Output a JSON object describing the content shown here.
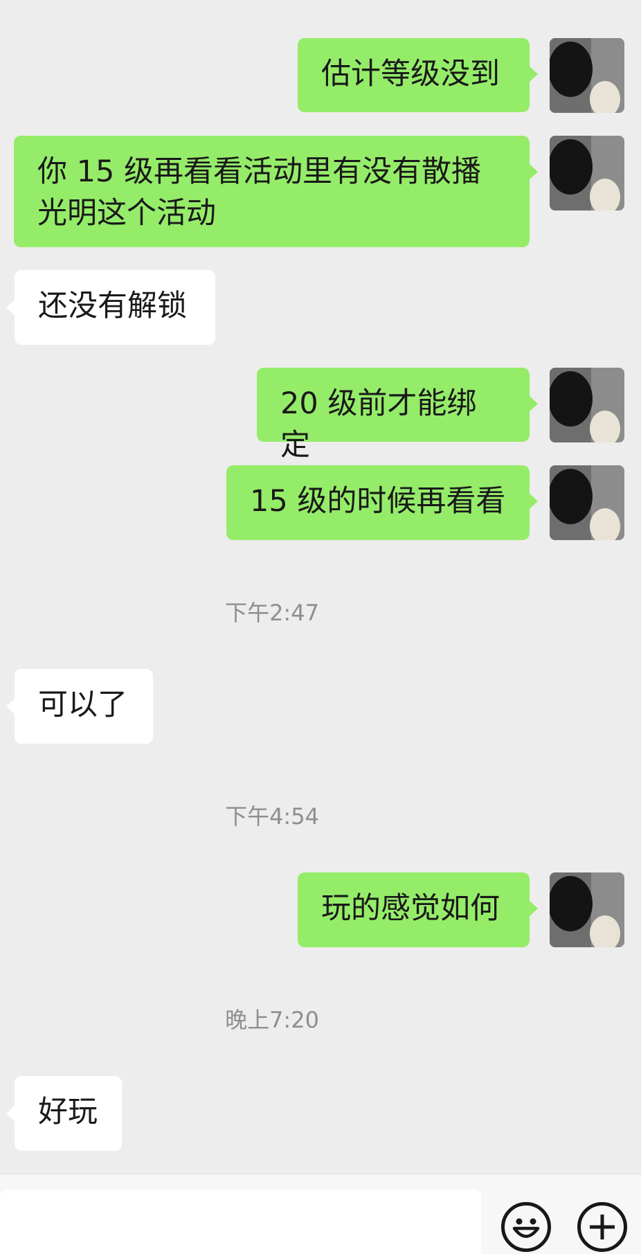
{
  "messages": [
    {
      "side": "me",
      "text": "估计等级没到"
    },
    {
      "side": "me",
      "text": "你 15 级再看看活动里有没有散播光明这个活动"
    },
    {
      "side": "them",
      "text": "还没有解锁"
    },
    {
      "side": "me",
      "text": "20 级前才能绑定"
    },
    {
      "side": "me",
      "text": "15 级的时候再看看"
    },
    {
      "side": "them",
      "text": "可以了"
    },
    {
      "side": "me",
      "text": "玩的感觉如何"
    },
    {
      "side": "them",
      "text": "好玩"
    }
  ],
  "timestamps": [
    "下午2:47",
    "下午4:54",
    "晚上7:20"
  ],
  "input": {
    "value": "",
    "placeholder": ""
  },
  "icons": {
    "emoji": "emoji-face-icon",
    "more": "plus-circle-icon"
  },
  "colors": {
    "my_bubble": "#95ec69",
    "their_bubble": "#ffffff",
    "background": "#ededed"
  }
}
